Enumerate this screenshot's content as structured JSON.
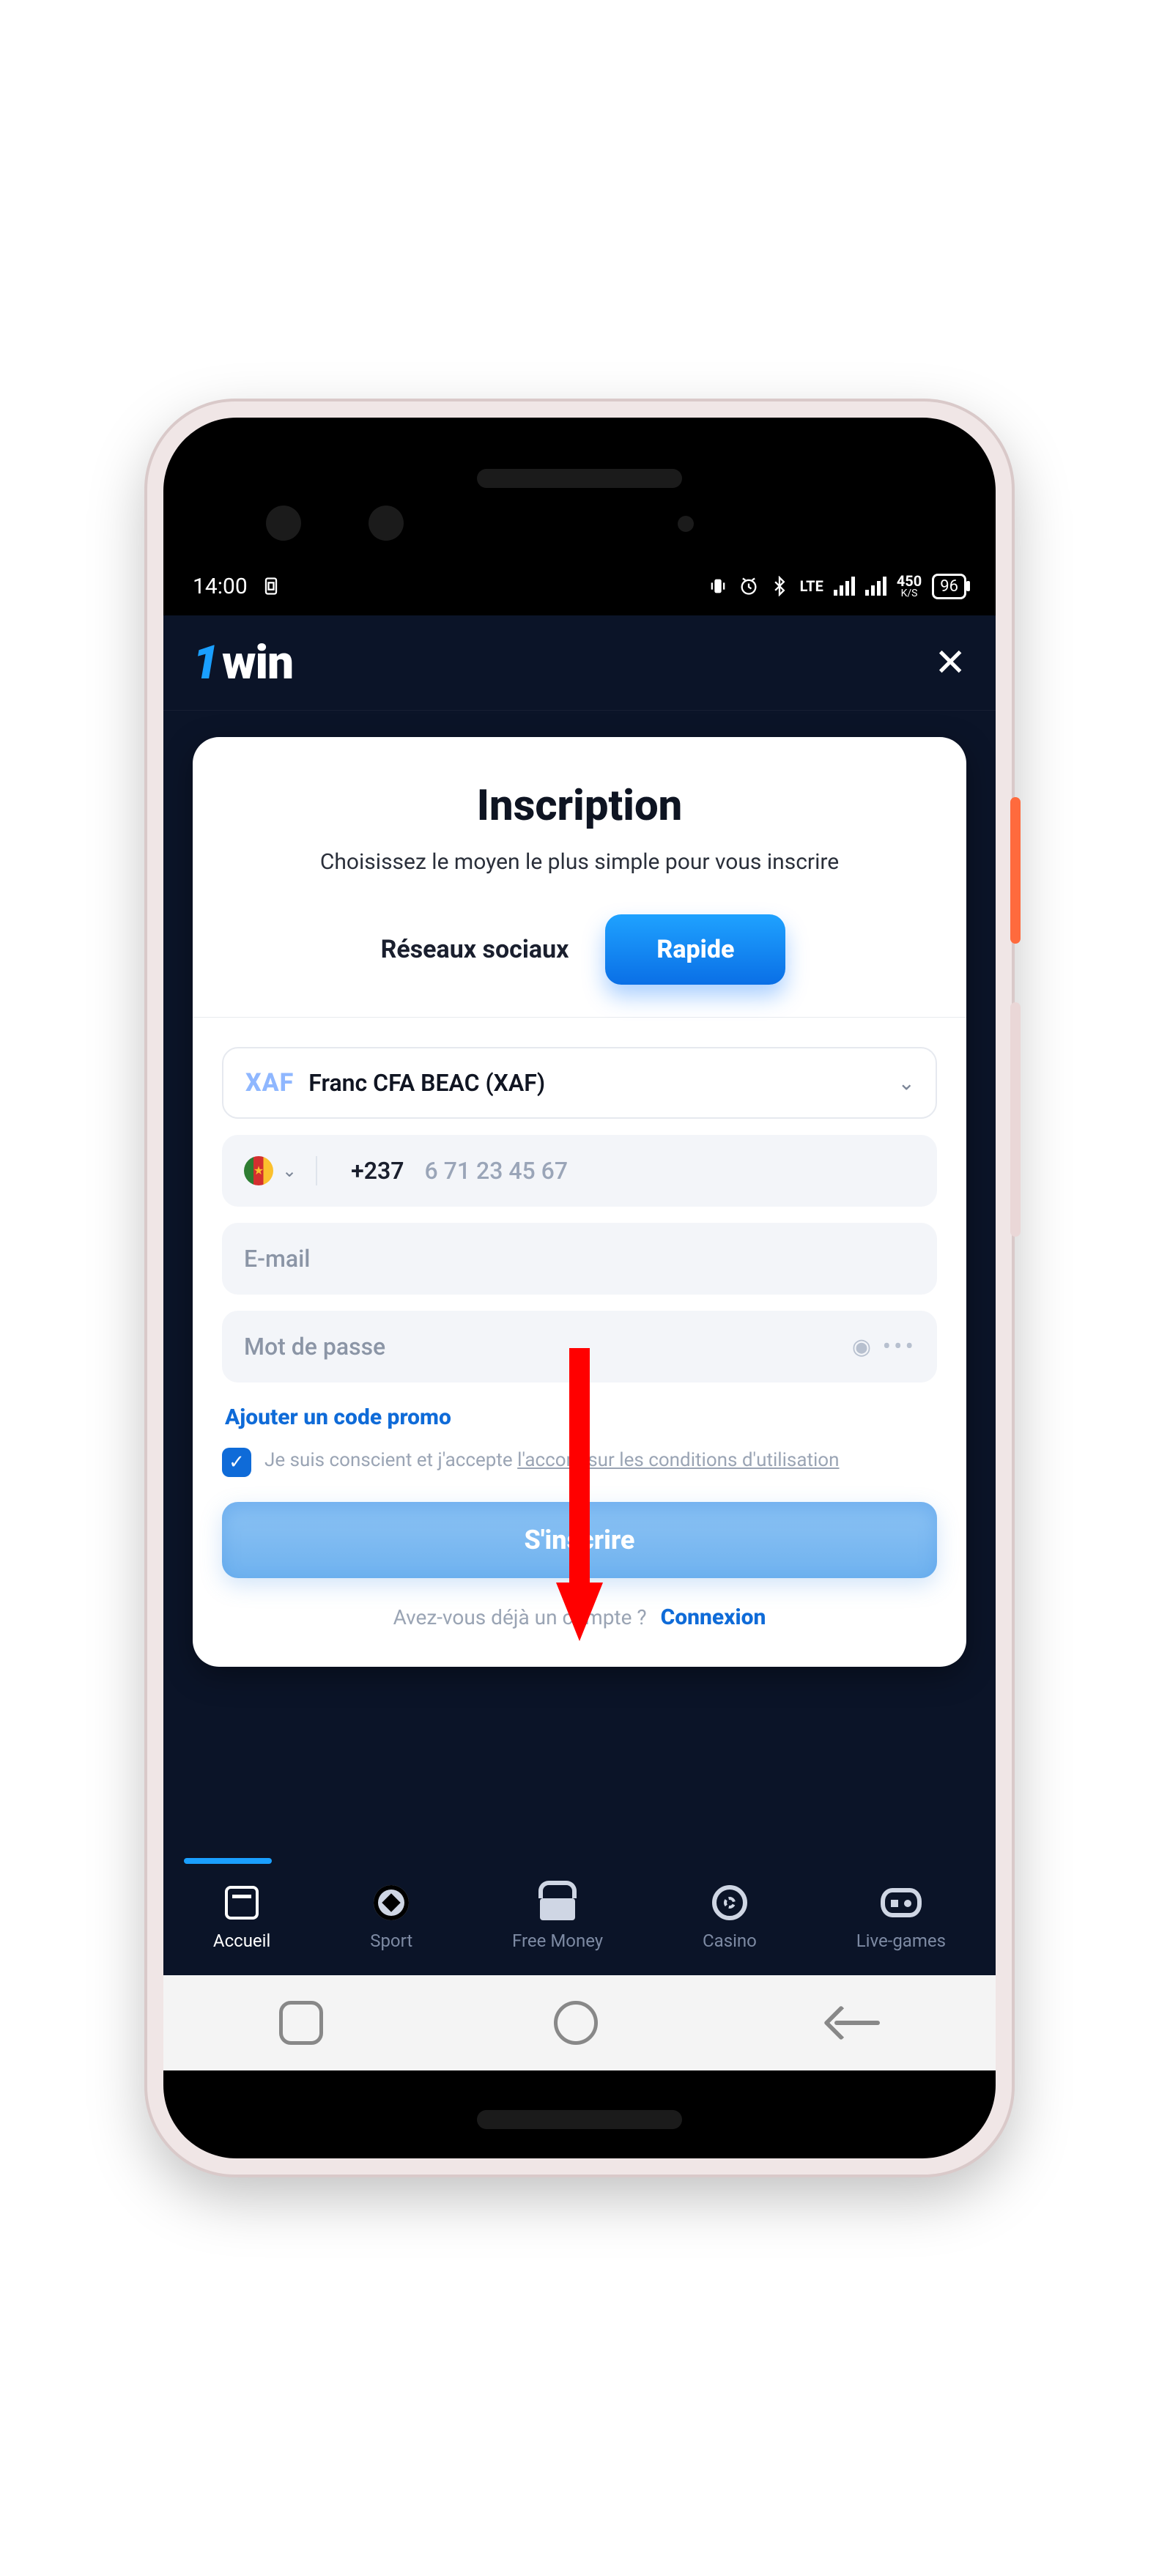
{
  "statusbar": {
    "time": "14:00",
    "lte": "LTE",
    "speed": "450",
    "speed_unit": "K/S",
    "battery": "96"
  },
  "header": {
    "logo_one": "1",
    "logo_win": "win",
    "close": "✕"
  },
  "card": {
    "title": "Inscription",
    "subtitle": "Choisissez le moyen le plus simple pour vous inscrire",
    "tab_social": "Réseaux sociaux",
    "tab_quick": "Rapide",
    "currency_code": "XAF",
    "currency_label": "Franc CFA BEAC (XAF)",
    "phone_prefix": "+237",
    "phone_placeholder": "6 71 23 45 67",
    "email_placeholder": "E-mail",
    "password_placeholder": "Mot de passe",
    "promo": "Ajouter un code promo",
    "terms_prefix": "Je suis conscient et j'accepte ",
    "terms_link": "l'accord sur les conditions d'utilisation",
    "submit": "S'inscrire",
    "already": "Avez-vous déjà un compte ?",
    "login": "Connexion"
  },
  "tabs": {
    "home": "Accueil",
    "sport": "Sport",
    "free": "Free Money",
    "casino": "Casino",
    "live": "Live-games"
  }
}
